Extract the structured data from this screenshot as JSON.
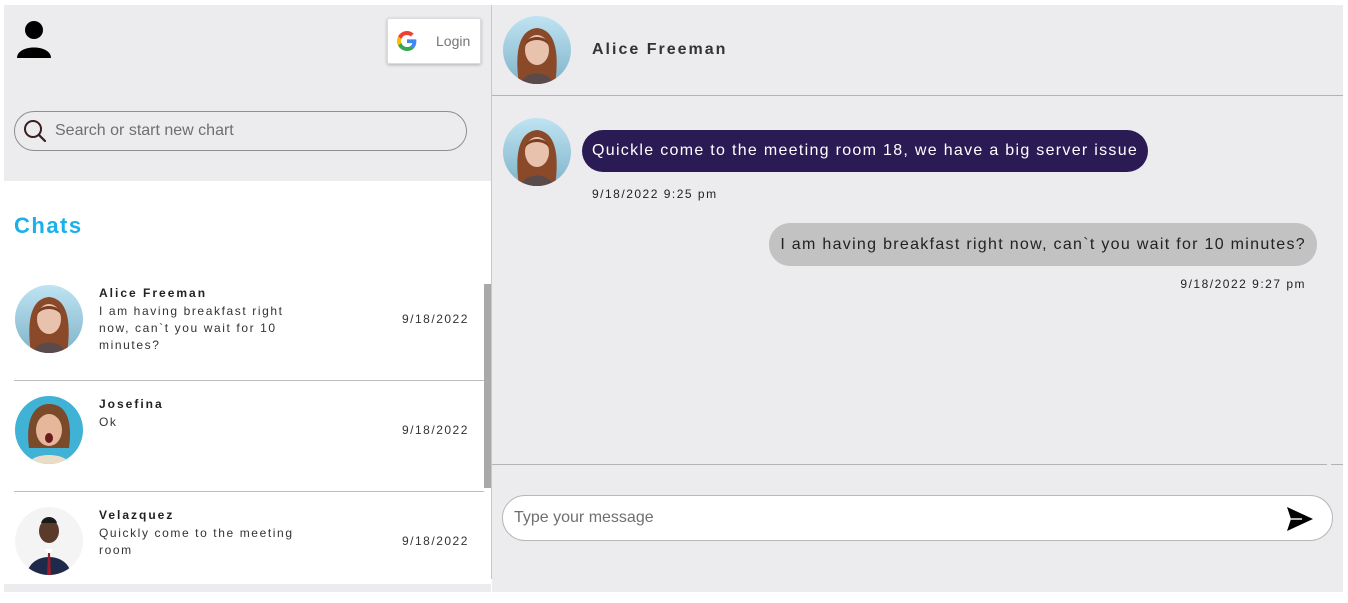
{
  "sidebar": {
    "login_label": "Login",
    "search_placeholder": "Search or start new chart",
    "chats_title": "Chats",
    "chats": [
      {
        "name": "Alice Freeman",
        "preview": "I am having breakfast right now, can`t you wait for 10 minutes?",
        "date": "9/18/2022",
        "avatar": "woman-red-hair"
      },
      {
        "name": "Josefina",
        "preview": "Ok",
        "date": "9/18/2022",
        "avatar": "woman-surprised"
      },
      {
        "name": "Velazquez",
        "preview": "Quickly come to the meeting room",
        "date": "9/18/2022",
        "avatar": "man-suit"
      }
    ]
  },
  "conversation": {
    "contact_name": "Alice Freeman",
    "messages": [
      {
        "direction": "incoming",
        "text": "Quickle come to the meeting room 18, we have a big server issue",
        "time": "9/18/2022 9:25 pm"
      },
      {
        "direction": "outgoing",
        "text": "I am having breakfast right now, can`t you wait for 10 minutes?",
        "time": "9/18/2022 9:27 pm"
      }
    ],
    "composer_placeholder": "Type your message"
  },
  "colors": {
    "accent": "#1ab0ea",
    "incoming_bubble": "#2b1b55",
    "outgoing_bubble": "#c2c2c2",
    "panel_bg": "#ececee"
  }
}
